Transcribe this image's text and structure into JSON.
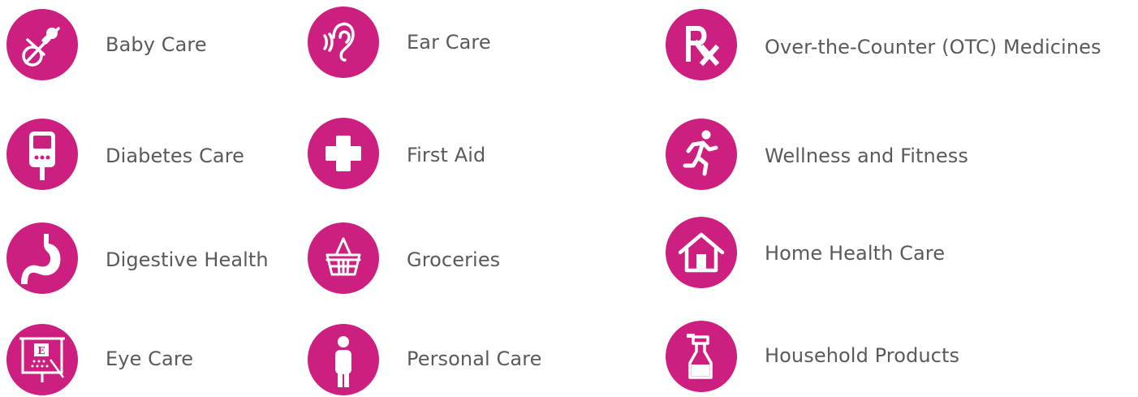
{
  "accent_color": "#cc1f7f",
  "label_color": "#5a5a5a",
  "categories": [
    {
      "label": "Baby Care",
      "icon": "pacifier-icon"
    },
    {
      "label": "Ear Care",
      "icon": "ear-icon"
    },
    {
      "label": "Over-the-Counter (OTC) Medicines",
      "icon": "rx-icon"
    },
    {
      "label": "Diabetes Care",
      "icon": "glucose-meter-icon"
    },
    {
      "label": "First Aid",
      "icon": "first-aid-cross-icon"
    },
    {
      "label": "Wellness and Fitness",
      "icon": "running-person-icon"
    },
    {
      "label": "Digestive Health",
      "icon": "stomach-icon"
    },
    {
      "label": "Groceries",
      "icon": "shopping-basket-icon"
    },
    {
      "label": "Home Health Care",
      "icon": "house-icon"
    },
    {
      "label": "Eye Care",
      "icon": "eye-chart-icon"
    },
    {
      "label": "Personal Care",
      "icon": "person-icon"
    },
    {
      "label": "Household Products",
      "icon": "spray-bottle-icon"
    }
  ]
}
